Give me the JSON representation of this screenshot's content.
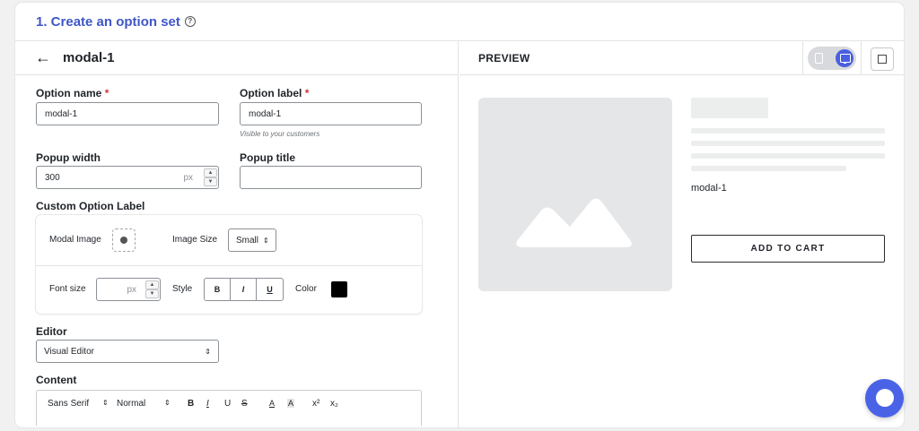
{
  "step": {
    "title": "1. Create an option set"
  },
  "editor_panel": {
    "title": "modal-1",
    "option_name": {
      "label": "Option name",
      "required": "*",
      "value": "modal-1"
    },
    "option_label": {
      "label": "Option label",
      "required": "*",
      "value": "modal-1",
      "hint": "Visible to your customers"
    },
    "popup_width": {
      "label": "Popup width",
      "value": "300",
      "unit": "px"
    },
    "popup_title": {
      "label": "Popup title",
      "value": ""
    },
    "custom_option_label": {
      "heading": "Custom Option Label",
      "modal_image_label": "Modal Image",
      "image_size_label": "Image Size",
      "image_size_value": "Small",
      "font_size_label": "Font size",
      "font_size_unit": "px",
      "style_label": "Style",
      "style_buttons": [
        "B",
        "I",
        "U"
      ],
      "color_label": "Color",
      "color_value": "#000000"
    },
    "editor": {
      "label": "Editor",
      "value": "Visual Editor"
    },
    "content": {
      "label": "Content",
      "toolbar": {
        "font": "Sans Serif",
        "size": "Normal",
        "bold": "B",
        "italic": "I",
        "underline": "U",
        "strike": "S",
        "text_color": "A",
        "bg_color": "A",
        "superscript": "x²",
        "subscript": "x₂"
      }
    }
  },
  "preview_panel": {
    "label": "PREVIEW",
    "product_name": "modal-1",
    "add_to_cart": "ADD TO CART",
    "active_device": "desktop"
  },
  "colors": {
    "accent": "#4a5fe0",
    "title": "#3f56c7",
    "required": "#d6303c"
  }
}
